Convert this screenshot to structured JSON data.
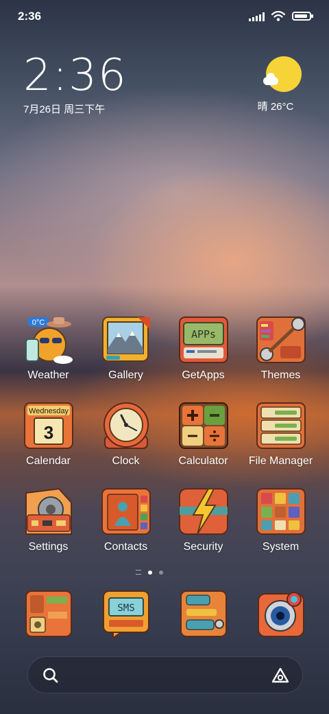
{
  "status_bar": {
    "time": "2:36",
    "battery_level": 0.9
  },
  "widget": {
    "time": "2:36",
    "date": "7月26日 周三下午",
    "weather": "晴 26°C"
  },
  "apps": [
    {
      "label": "Weather",
      "badge": "0°C",
      "icon": "weather-icon"
    },
    {
      "label": "Gallery",
      "icon": "gallery-icon"
    },
    {
      "label": "GetApps",
      "icon": "getapps-icon",
      "screen_text": "APPs"
    },
    {
      "label": "Themes",
      "icon": "themes-icon"
    },
    {
      "label": "Calendar",
      "icon": "calendar-icon",
      "weekday": "Wednesday",
      "day": "3"
    },
    {
      "label": "Clock",
      "icon": "clock-icon"
    },
    {
      "label": "Calculator",
      "icon": "calculator-icon"
    },
    {
      "label": "File Manager",
      "icon": "file-manager-icon"
    },
    {
      "label": "Settings",
      "icon": "settings-icon"
    },
    {
      "label": "Contacts",
      "icon": "contacts-icon"
    },
    {
      "label": "Security",
      "icon": "security-icon"
    },
    {
      "label": "System",
      "icon": "system-folder-icon"
    }
  ],
  "dock": [
    {
      "icon": "phone-icon"
    },
    {
      "icon": "sms-icon",
      "screen_text": "SMS"
    },
    {
      "icon": "browser-icon"
    },
    {
      "icon": "camera-icon"
    }
  ],
  "page_indicator": {
    "pages": 2,
    "current": 1
  },
  "colors": {
    "icon_orange": "#e07a3a",
    "sun": "#f6d336"
  }
}
